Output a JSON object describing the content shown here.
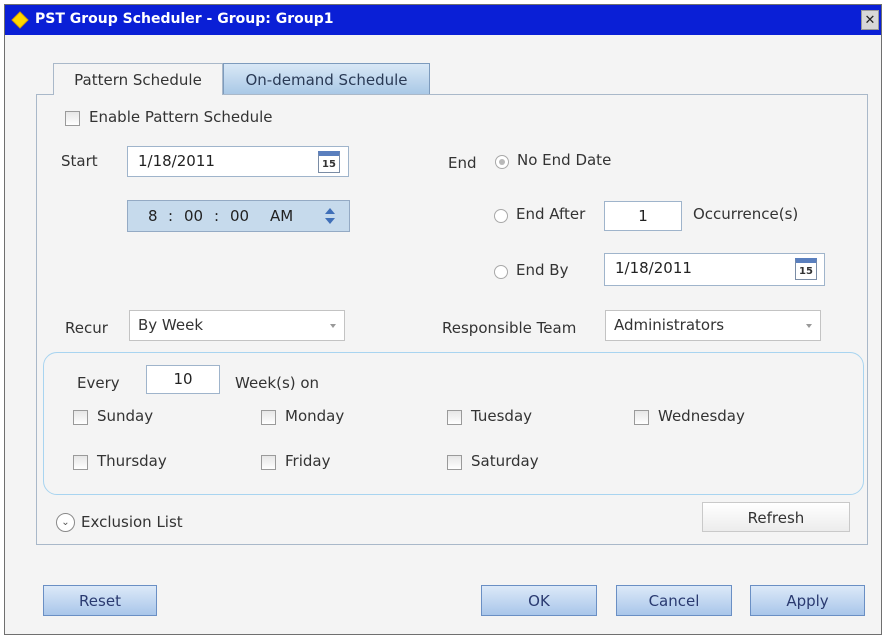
{
  "window": {
    "title": "PST Group Scheduler - Group: Group1",
    "close_glyph": "✕"
  },
  "tabs": [
    {
      "label": "Pattern Schedule",
      "active": true
    },
    {
      "label": "On-demand Schedule",
      "active": false
    }
  ],
  "pattern": {
    "enable_label": "Enable Pattern Schedule",
    "enable_checked": false,
    "start_label": "Start",
    "start_date": "1/18/2011",
    "calendar_day": "15",
    "time": {
      "hour": "8",
      "sep1": ":",
      "minute": "00",
      "sep2": ":",
      "second": "00",
      "ampm": "AM"
    },
    "end_label": "End",
    "end_options": {
      "no_end_label": "No End Date",
      "end_after_label": "End After",
      "occurrences_value": "1",
      "occurrences_label": "Occurrence(s)",
      "end_by_label": "End By",
      "end_by_date": "1/18/2011",
      "selected": "No End Date"
    },
    "recur_label": "Recur",
    "recur_value": "By Week",
    "team_label": "Responsible Team",
    "team_value": "Administrators",
    "every_label": "Every",
    "every_value": "10",
    "weeks_label": "Week(s) on",
    "days": [
      {
        "label": "Sunday",
        "checked": false
      },
      {
        "label": "Monday",
        "checked": false
      },
      {
        "label": "Tuesday",
        "checked": false
      },
      {
        "label": "Wednesday",
        "checked": false
      },
      {
        "label": "Thursday",
        "checked": false
      },
      {
        "label": "Friday",
        "checked": false
      },
      {
        "label": "Saturday",
        "checked": false
      }
    ],
    "exclusion_label": "Exclusion List",
    "refresh_label": "Refresh"
  },
  "footer": {
    "reset_label": "Reset",
    "ok_label": "OK",
    "cancel_label": "Cancel",
    "apply_label": "Apply"
  },
  "colors": {
    "titlebar": "#0a1fd6",
    "accent": "#a9c6ea",
    "window_bg": "#f4f4f4"
  },
  "icons": {
    "title": "diamond-icon",
    "calendar": "calendar-icon",
    "spinner": "spinner-icon",
    "expand": "chevron-down-circle-icon",
    "dropdown": "chevron-down-icon"
  }
}
